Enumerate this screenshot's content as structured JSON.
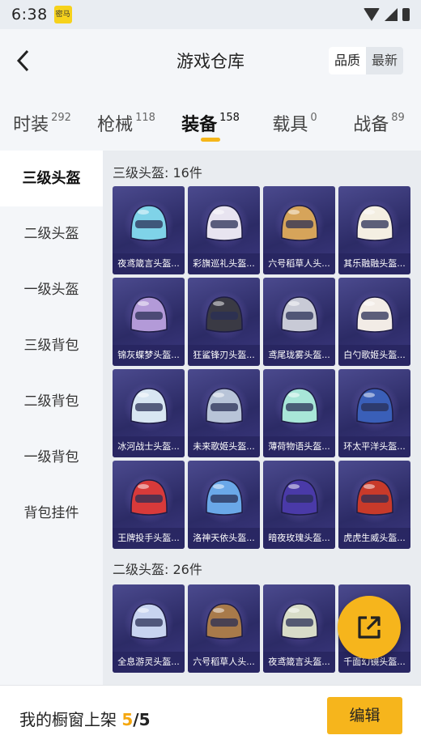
{
  "status": {
    "time": "6:38",
    "notif_label": "密马"
  },
  "header": {
    "title": "游戏仓库",
    "sort_quality": "品质",
    "sort_latest": "最新"
  },
  "tabs": [
    {
      "label": "时装",
      "count": "292"
    },
    {
      "label": "枪械",
      "count": "118"
    },
    {
      "label": "装备",
      "count": "158"
    },
    {
      "label": "载具",
      "count": "0"
    },
    {
      "label": "战备",
      "count": "89"
    }
  ],
  "sidebar": [
    {
      "label": "三级头盔"
    },
    {
      "label": "二级头盔"
    },
    {
      "label": "一级头盔"
    },
    {
      "label": "三级背包"
    },
    {
      "label": "二级背包"
    },
    {
      "label": "一级背包"
    },
    {
      "label": "背包挂件"
    }
  ],
  "sections": [
    {
      "title": "三级头盔: 16件",
      "items": [
        {
          "name": "夜鸢箴言头盔...",
          "color": "#7fd3e8"
        },
        {
          "name": "彩旗巡礼头盔...",
          "color": "#e8e4f0"
        },
        {
          "name": "六号稻草人头...",
          "color": "#d6a45a"
        },
        {
          "name": "其乐融融头盔...",
          "color": "#f4efe2"
        },
        {
          "name": "锦灰蝶梦头盔...",
          "color": "#b39ad8"
        },
        {
          "name": "狂鲨锋刃头盔...",
          "color": "#3a3a44"
        },
        {
          "name": "鸢尾珑雾头盔...",
          "color": "#c8cad6"
        },
        {
          "name": "白勺歌姬头盔...",
          "color": "#f2ece6"
        },
        {
          "name": "冰河战士头盔...",
          "color": "#d8e6f2"
        },
        {
          "name": "未来歌姬头盔...",
          "color": "#b8c4d8"
        },
        {
          "name": "薄荷物语头盔...",
          "color": "#a8e6d8"
        },
        {
          "name": "环太平洋头盔...",
          "color": "#3a5fb8"
        },
        {
          "name": "王牌投手头盔...",
          "color": "#d83a3a"
        },
        {
          "name": "洛神天依头盔...",
          "color": "#6aa8e8"
        },
        {
          "name": "暗夜玫瑰头盔...",
          "color": "#4a3aa8"
        },
        {
          "name": "虎虎生威头盔...",
          "color": "#c83a2a"
        }
      ]
    },
    {
      "title": "二级头盔: 26件",
      "items": [
        {
          "name": "全息游灵头盔...",
          "color": "#c8d4f0"
        },
        {
          "name": "六号稻草人头...",
          "color": "#a87a4a"
        },
        {
          "name": "夜鸢箴言头盔...",
          "color": "#d8dcc8"
        },
        {
          "name": "千面幻镜头盔...",
          "color": "#3a4a98"
        }
      ]
    }
  ],
  "bottom": {
    "shelf_label": "我的橱窗上架",
    "shelf_count": "5",
    "shelf_total": "/5",
    "edit_label": "编辑"
  }
}
